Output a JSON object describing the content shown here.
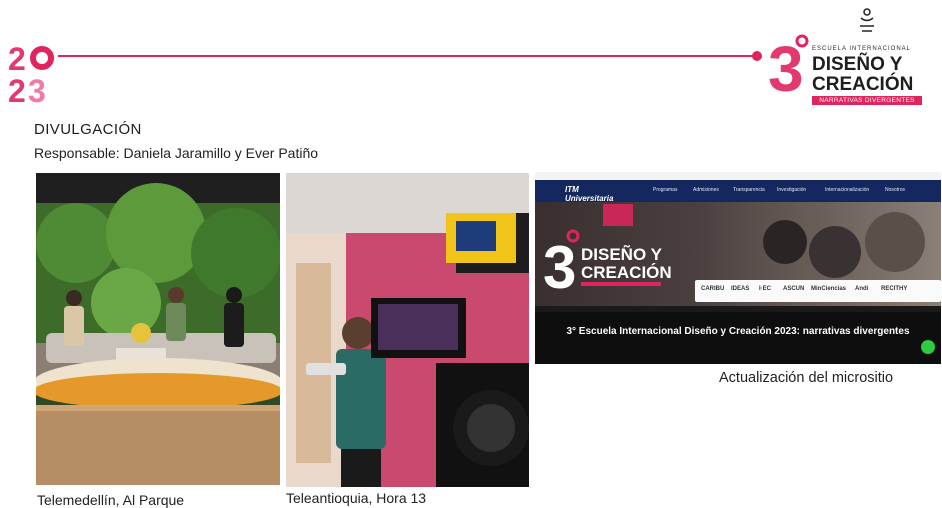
{
  "header": {
    "year_mark": "2023",
    "event_logo": {
      "numeral": "3",
      "line1": "ESCUELA INTERNACIONAL",
      "line2": "DISEÑO Y",
      "line3": "CREACIÓN",
      "tagline": "NARRATIVAS DIVERGENTES"
    },
    "accent_color": "#e0245e"
  },
  "section": {
    "title": "DIVULGACIÓN",
    "responsible": "Responsable: Daniela Jaramillo y Ever Patiño"
  },
  "photos": [
    {
      "caption": "Telemedellín, Al Parque"
    },
    {
      "caption": "Teleantioquia, Hora 13"
    },
    {
      "caption": "Actualización del micrositio",
      "microsite": {
        "logo": "ITM Universitaria",
        "nav_items": [
          "Programas",
          "Admisiones",
          "Transparencia",
          "Investigación",
          "Internacionalización",
          "Nosotros"
        ],
        "banner_numeral": "3",
        "banner_line1": "DISEÑO Y",
        "banner_line2": "CREACIÓN",
        "sponsors": [
          "CARIBU",
          "IDEAS",
          "I·EC",
          "ASCUN",
          "MinCiencias",
          "Andi",
          "RECITHY"
        ],
        "headline": "3° Escuela Internacional Diseño y Creación 2023: narrativas divergentes"
      }
    }
  ]
}
